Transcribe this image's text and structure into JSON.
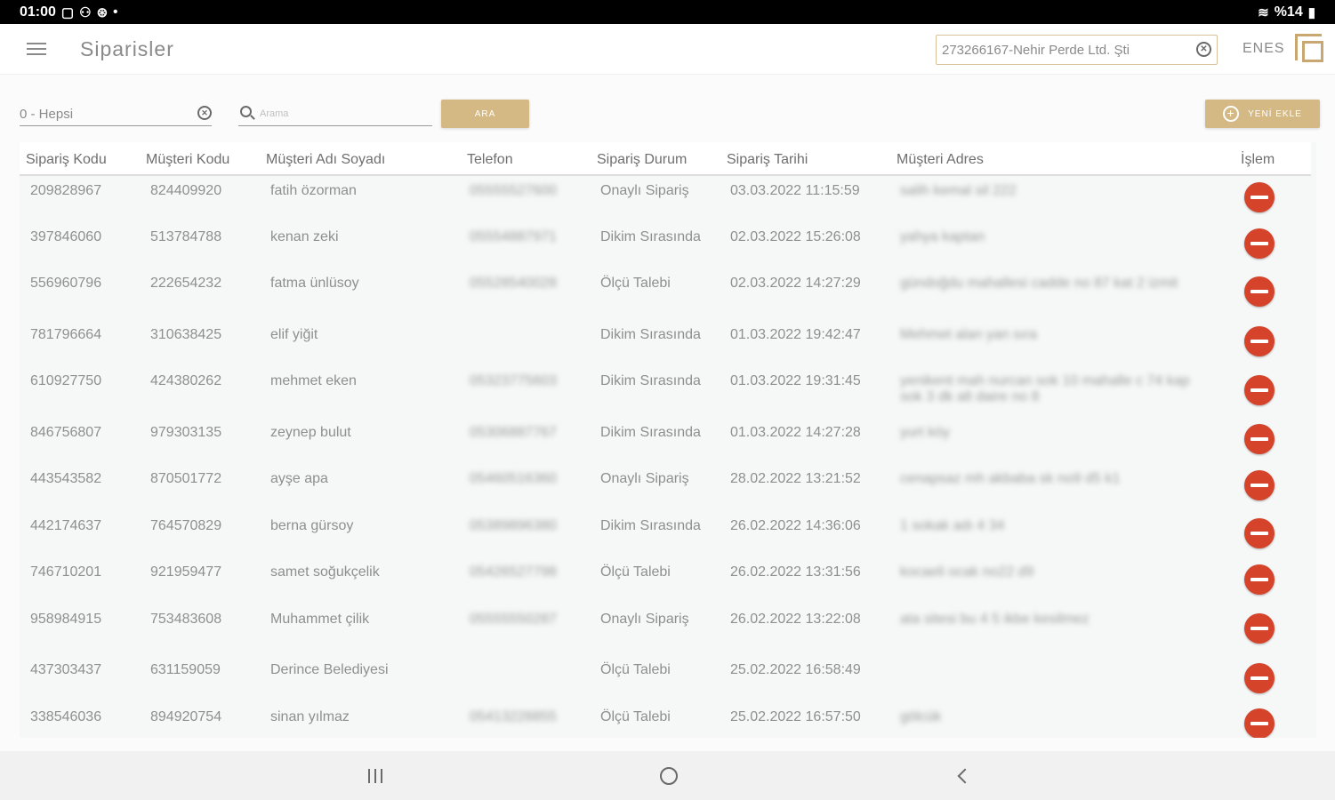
{
  "status_bar": {
    "time": "01:00",
    "battery": "%14"
  },
  "app_bar": {
    "title": "Siparisler",
    "company": "273266167-Nehir Perde Ltd. Şti",
    "user": "ENES"
  },
  "toolbar": {
    "filter_value": "0 - Hepsi",
    "search_placeholder": "Arama",
    "search_button": "ARA",
    "new_button": "YENİ EKLE"
  },
  "table": {
    "columns": [
      "Sipariş Kodu",
      "Müşteri Kodu",
      "Müşteri Adı Soyadı",
      "Telefon",
      "Sipariş Durum",
      "Sipariş Tarihi",
      "Müşteri Adres",
      "İşlem"
    ],
    "rows": [
      {
        "code": "209828967",
        "customer_code": "824409920",
        "name": "fatih özorman",
        "phone": "05555527600",
        "status": "Onaylı Sipariş",
        "date": "03.03.2022 11:15:59",
        "address": "salih kemal sil 222"
      },
      {
        "code": "397846060",
        "customer_code": "513784788",
        "name": "kenan zeki",
        "phone": "05554887971",
        "status": "Dikim Sırasında",
        "date": "02.03.2022 15:26:08",
        "address": "yahya kaptan"
      },
      {
        "code": "556960796",
        "customer_code": "222654232",
        "name": "fatma ünlüsoy",
        "phone": "05528540028",
        "status": "Ölçü Talebi",
        "date": "02.03.2022 14:27:29",
        "address": "gündoğdu mahallesi cadde no 87 kat 2 izmit"
      },
      {
        "code": "781796664",
        "customer_code": "310638425",
        "name": "elif yiğit",
        "phone": "",
        "status": "Dikim Sırasında",
        "date": "01.03.2022 19:42:47",
        "address": "Mehmet alan yan sıra"
      },
      {
        "code": "610927750",
        "customer_code": "424380262",
        "name": "mehmet eken",
        "phone": "05323775603",
        "status": "Dikim Sırasında",
        "date": "01.03.2022 19:31:45",
        "address": "yenikent mah nurcan sok 10 mahalle c 74 kap sok 3 dk alt daire no 8"
      },
      {
        "code": "846756807",
        "customer_code": "979303135",
        "name": "zeynep bulut",
        "phone": "05306887767",
        "status": "Dikim Sırasında",
        "date": "01.03.2022 14:27:28",
        "address": "yurt köy"
      },
      {
        "code": "443543582",
        "customer_code": "870501772",
        "name": "ayşe apa",
        "phone": "05460516360",
        "status": "Onaylı Sipariş",
        "date": "28.02.2022 13:21:52",
        "address": "cenapsaz mh akbaba sk no9 d5 k1"
      },
      {
        "code": "442174637",
        "customer_code": "764570829",
        "name": "berna gürsoy",
        "phone": "05389896380",
        "status": "Dikim Sırasında",
        "date": "26.02.2022 14:36:06",
        "address": "1 sokak adı 4 34"
      },
      {
        "code": "746710201",
        "customer_code": "921959477",
        "name": "samet soğukçelik",
        "phone": "05426527798",
        "status": "Ölçü Talebi",
        "date": "26.02.2022 13:31:56",
        "address": "kocaeli ocak no22 d9"
      },
      {
        "code": "958984915",
        "customer_code": "753483608",
        "name": "Muhammet çilik",
        "phone": "05555550287",
        "status": "Onaylı Sipariş",
        "date": "26.02.2022 13:22:08",
        "address": "ata sitesi bu 4 5 ikbe kesilmez"
      },
      {
        "code": "437303437",
        "customer_code": "631159059",
        "name": "Derince Belediyesi",
        "phone": "",
        "status": "Ölçü Talebi",
        "date": "25.02.2022 16:58:49",
        "address": ""
      },
      {
        "code": "338546036",
        "customer_code": "894920754",
        "name": "sinan yılmaz",
        "phone": "05413228855",
        "status": "Ölçü Talebi",
        "date": "25.02.2022 16:57:50",
        "address": "gölcük"
      }
    ]
  },
  "colors": {
    "accent_gold": "#d5b985",
    "delete_red": "#d6432b"
  }
}
